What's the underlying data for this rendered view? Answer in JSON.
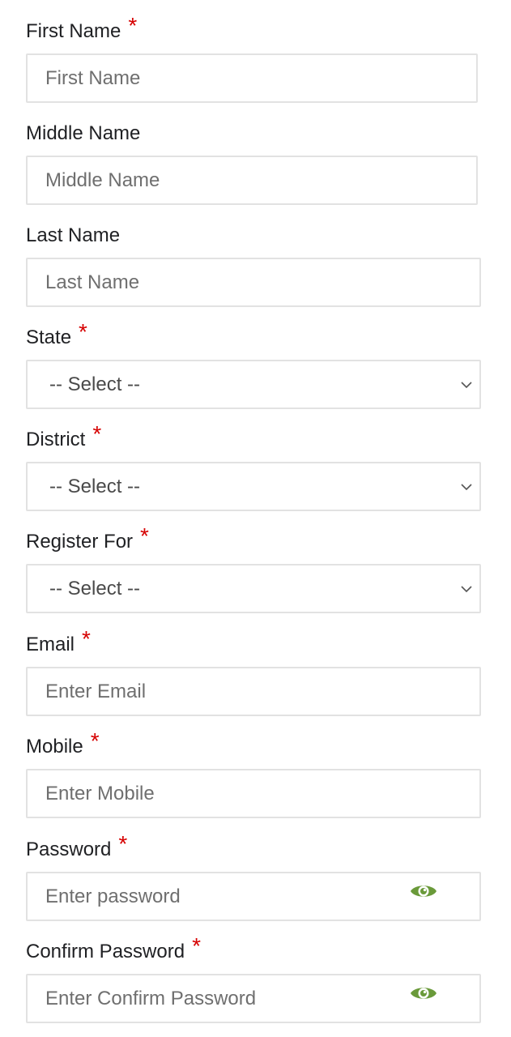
{
  "required_mark": "*",
  "fields": {
    "first_name": {
      "label": "First Name",
      "placeholder": "First Name"
    },
    "middle_name": {
      "label": "Middle Name",
      "placeholder": "Middle Name"
    },
    "last_name": {
      "label": "Last Name",
      "placeholder": "Last Name"
    },
    "state": {
      "label": "State",
      "selected": "-- Select --"
    },
    "district": {
      "label": "District",
      "selected": "-- Select --"
    },
    "register_for": {
      "label": "Register For",
      "selected": "-- Select --"
    },
    "email": {
      "label": "Email",
      "placeholder": "Enter Email"
    },
    "mobile": {
      "label": "Mobile",
      "placeholder": "Enter Mobile"
    },
    "password": {
      "label": "Password",
      "placeholder": "Enter password"
    },
    "confirm_password": {
      "label": "Confirm Password",
      "placeholder": "Enter Confirm Password"
    }
  },
  "icons": {
    "eye": "eye-icon",
    "chevron": "chevron-down-icon"
  },
  "colors": {
    "required": "#d60000",
    "eye_icon": "#6a9a3a",
    "border": "#e2e2e2"
  }
}
